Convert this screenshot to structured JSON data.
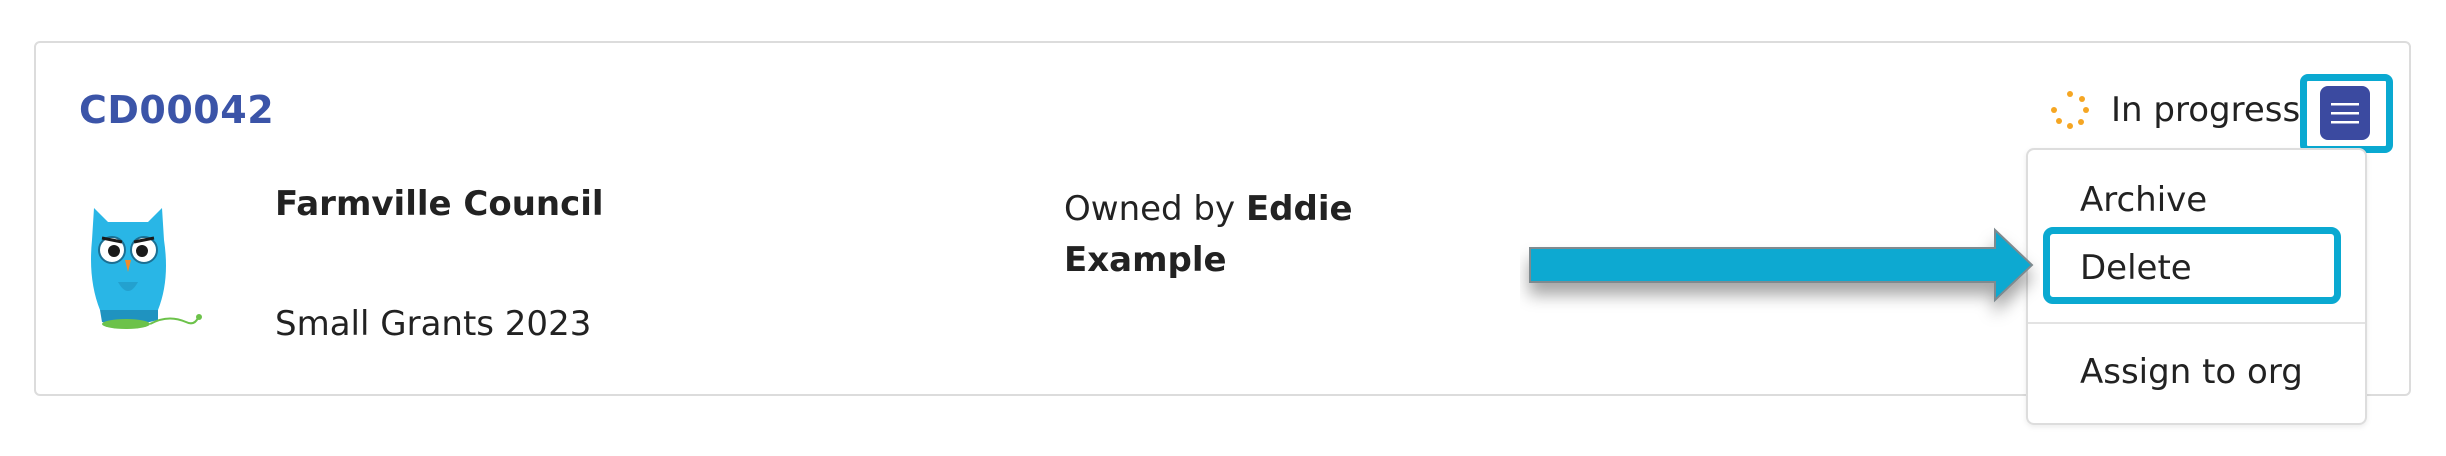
{
  "application": {
    "id": "CD00042",
    "organisation": "Farmville Council",
    "round": "Small Grants 2023",
    "owner_prefix": "Owned by",
    "owner_name": "Eddie Example"
  },
  "status": {
    "label": "In progress",
    "color": "#f5a623"
  },
  "menu": {
    "items": [
      {
        "label": "Archive"
      },
      {
        "label": "Delete"
      },
      {
        "label": "Assign to org"
      }
    ]
  },
  "colors": {
    "accent": "#3b54a8",
    "menu_button": "#3b4aa0",
    "highlight": "#0aa9d1"
  }
}
